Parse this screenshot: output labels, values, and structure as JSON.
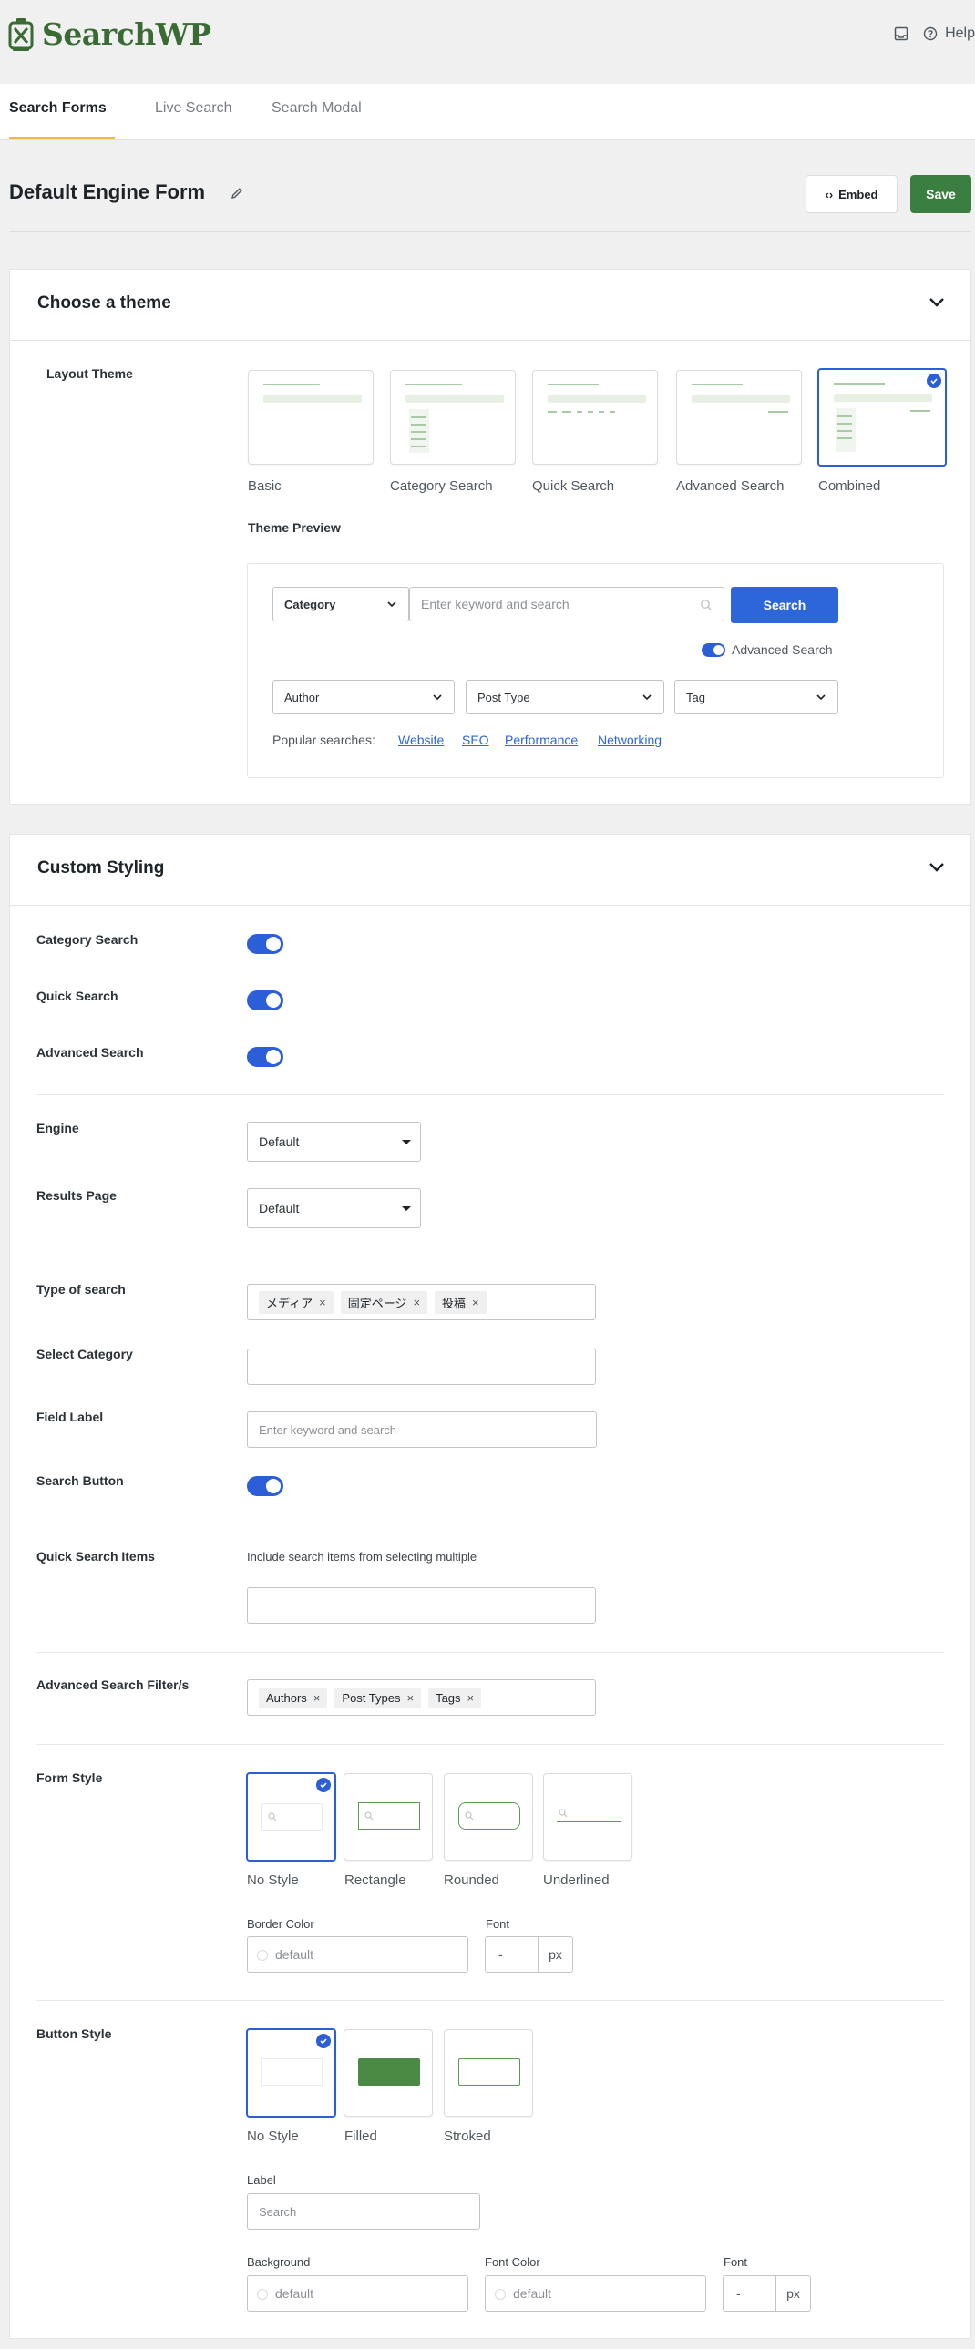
{
  "app": {
    "logo_text": "SearchWP",
    "help_label": "Help"
  },
  "tabs": [
    {
      "label": "Search Forms",
      "active": true
    },
    {
      "label": "Live Search",
      "active": false
    },
    {
      "label": "Search Modal",
      "active": false
    }
  ],
  "header": {
    "title": "Default Engine Form",
    "embed_label": "Embed",
    "save_label": "Save"
  },
  "theme_panel": {
    "title": "Choose a theme",
    "layout_label": "Layout Theme",
    "themes": [
      "Basic",
      "Category Search",
      "Quick Search",
      "Advanced Search",
      "Combined"
    ],
    "selected_theme": "Combined",
    "preview_label": "Theme Preview",
    "preview": {
      "category": "Category",
      "search_placeholder": "Enter keyword and search",
      "search_button": "Search",
      "advanced_toggle": "Advanced Search",
      "filters": [
        "Author",
        "Post Type",
        "Tag"
      ],
      "popular_label": "Popular searches:",
      "popular_links": [
        "Website",
        "SEO",
        "Performance",
        "Networking"
      ]
    }
  },
  "styling_panel": {
    "title": "Custom Styling",
    "category_search_label": "Category Search",
    "quick_search_label": "Quick Search",
    "advanced_search_label": "Advanced Search",
    "engine_label": "Engine",
    "engine_value": "Default",
    "results_page_label": "Results Page",
    "results_page_value": "Default",
    "type_of_search_label": "Type of search",
    "type_of_search_chips": [
      "メディア",
      "固定ページ",
      "投稿"
    ],
    "select_category_label": "Select Category",
    "field_label_label": "Field Label",
    "field_label_placeholder": "Enter keyword and search",
    "search_button_label": "Search Button",
    "quick_items_label": "Quick Search Items",
    "quick_items_help": "Include search items from selecting multiple",
    "adv_filters_label": "Advanced Search Filter/s",
    "adv_filter_chips": [
      "Authors",
      "Post Types",
      "Tags"
    ],
    "form_style_label": "Form Style",
    "form_styles": [
      "No Style",
      "Rectangle",
      "Rounded",
      "Underlined"
    ],
    "border_color_label": "Border Color",
    "border_color_value": "default",
    "font_label": "Font",
    "font_value": "-",
    "font_unit": "px",
    "button_style_label": "Button Style",
    "button_styles": [
      "No Style",
      "Filled",
      "Stroked"
    ],
    "button_label_label": "Label",
    "button_label_placeholder": "Search",
    "background_label": "Background",
    "background_value": "default",
    "font_color_label": "Font Color",
    "font_color_value": "default",
    "button_font_label": "Font",
    "button_font_value": "-",
    "button_font_unit": "px"
  },
  "colors": {
    "brand_green": "#3a7f3f",
    "accent_blue": "#2c5ed8",
    "tab_underline": "#f0b849"
  }
}
